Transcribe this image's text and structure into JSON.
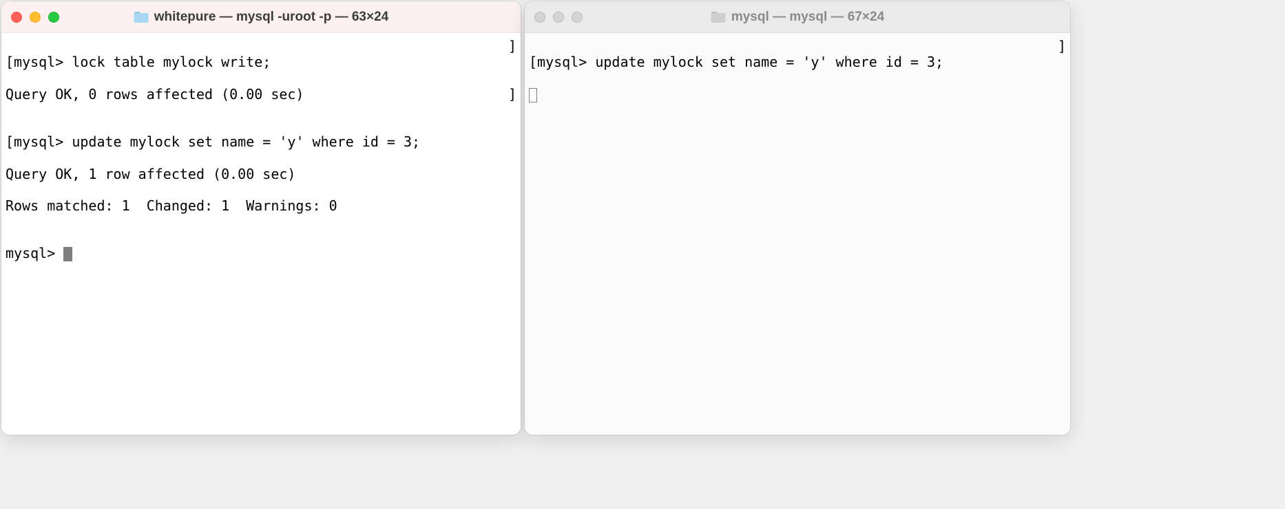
{
  "leftWindow": {
    "title": "whitepure — mysql -uroot -p — 63×24",
    "active": true,
    "lines": {
      "l0_prompt": "mysql> ",
      "l0_cmd": "lock table mylock write;",
      "l1": "Query OK, 0 rows affected (0.00 sec)",
      "l2": "",
      "l3_prompt": "mysql> ",
      "l3_cmd": "update mylock set name = 'y' where id = 3;",
      "l4": "Query OK, 1 row affected (0.00 sec)",
      "l5": "Rows matched: 1  Changed: 1  Warnings: 0",
      "l6": "",
      "l7_prompt": "mysql> "
    }
  },
  "rightWindow": {
    "title": "mysql — mysql — 67×24",
    "active": false,
    "lines": {
      "l0_prompt": "mysql> ",
      "l0_cmd": "update mylock set name = 'y' where id = 3;"
    }
  },
  "glyphs": {
    "open_bracket": "[",
    "close_bracket": "]"
  }
}
